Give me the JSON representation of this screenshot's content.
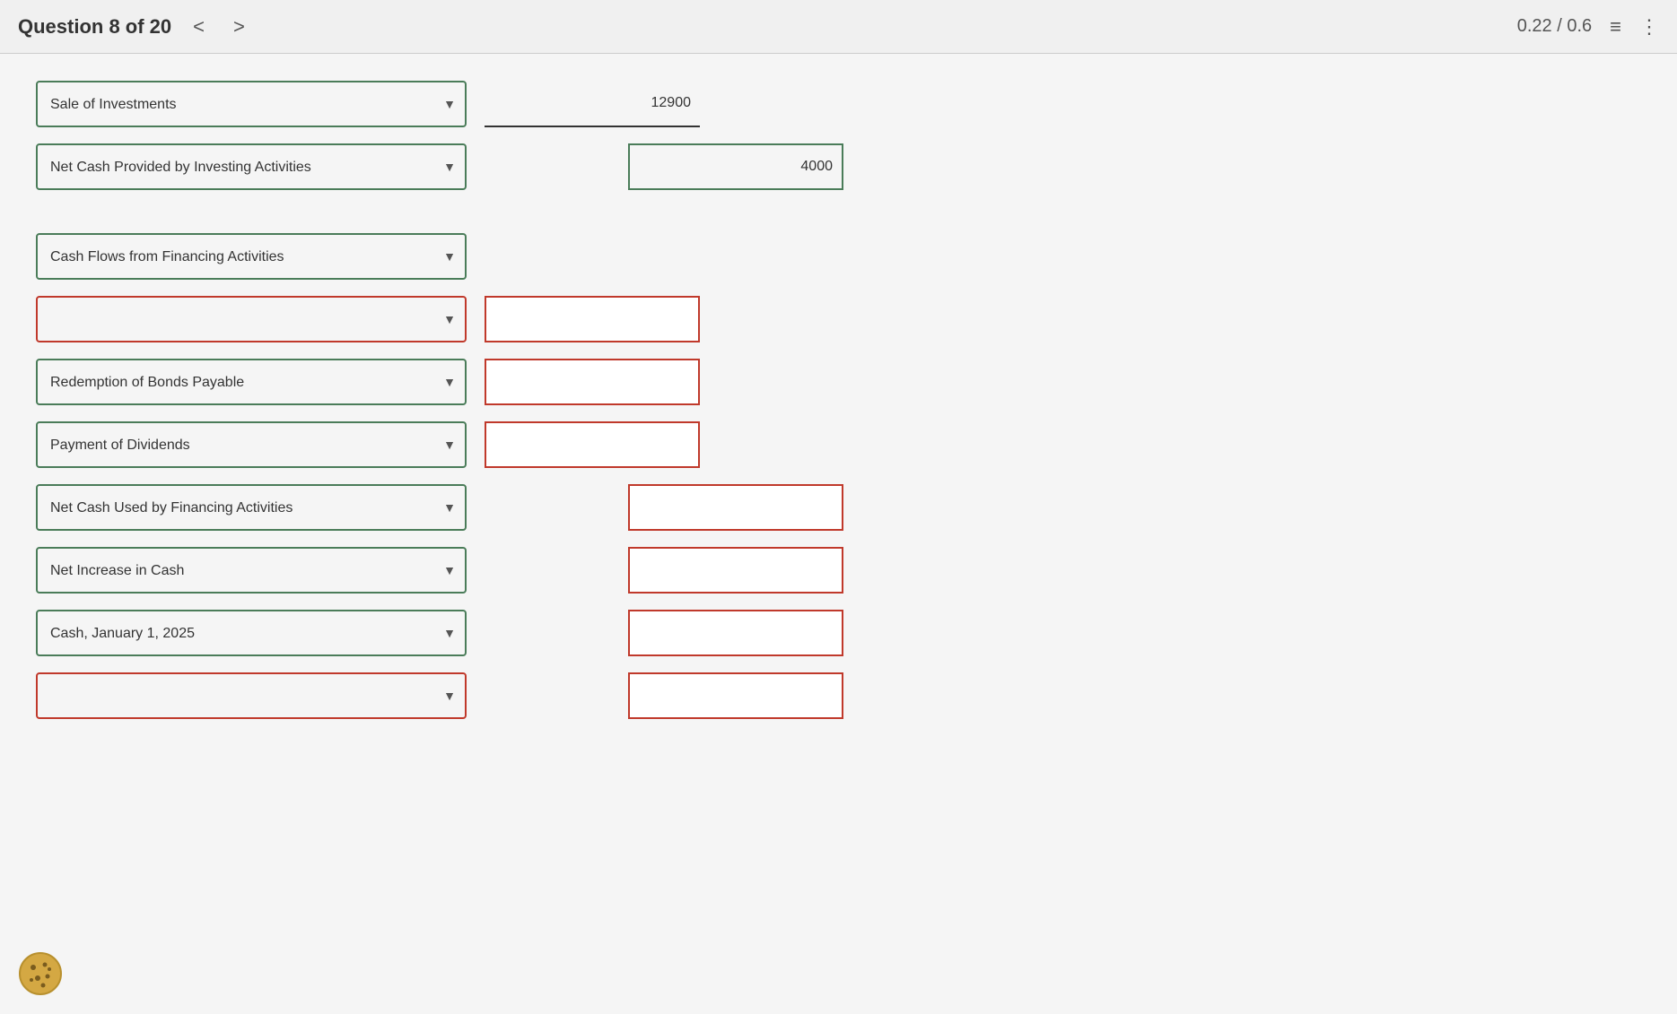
{
  "header": {
    "question_label": "Question 8 of 20",
    "nav_prev": "<",
    "nav_next": ">",
    "score": "0.22 / 0.6",
    "list_icon": "≡",
    "menu_icon": "⋮"
  },
  "rows": [
    {
      "id": "sale-investments",
      "dropdown_label": "Sale of Investments",
      "dropdown_border": "green",
      "col1_value": "12900",
      "col1_border": "underline",
      "col2_value": "",
      "col2_border": "none"
    },
    {
      "id": "net-cash-investing",
      "dropdown_label": "Net Cash Provided by Investing Activities",
      "dropdown_border": "green",
      "col1_value": "",
      "col1_border": "none",
      "col2_value": "4000",
      "col2_border": "green"
    },
    {
      "id": "gap1",
      "type": "gap"
    },
    {
      "id": "cash-flows-financing",
      "dropdown_label": "Cash Flows from Financing Activities",
      "dropdown_border": "green",
      "col1_value": "",
      "col1_border": "none",
      "col2_value": "",
      "col2_border": "none",
      "show_inputs": false
    },
    {
      "id": "blank-row",
      "dropdown_label": "",
      "dropdown_border": "red",
      "col1_value": "",
      "col1_border": "red",
      "col2_value": "",
      "col2_border": "none"
    },
    {
      "id": "redemption-bonds",
      "dropdown_label": "Redemption of Bonds Payable",
      "dropdown_border": "green",
      "col1_value": "",
      "col1_border": "red",
      "col2_value": "",
      "col2_border": "none"
    },
    {
      "id": "payment-dividends",
      "dropdown_label": "Payment of Dividends",
      "dropdown_border": "green",
      "col1_value": "",
      "col1_border": "red",
      "col2_value": "",
      "col2_border": "none",
      "underline_col1": true
    },
    {
      "id": "net-cash-financing",
      "dropdown_label": "Net Cash Used by Financing Activities",
      "dropdown_border": "green",
      "col1_value": "",
      "col1_border": "none",
      "col2_value": "",
      "col2_border": "red"
    },
    {
      "id": "net-increase-cash",
      "dropdown_label": "Net Increase in Cash",
      "dropdown_border": "green",
      "col1_value": "",
      "col1_border": "none",
      "col2_value": "",
      "col2_border": "red"
    },
    {
      "id": "cash-jan",
      "dropdown_label": "Cash, January 1, 2025",
      "dropdown_border": "green",
      "col1_value": "",
      "col1_border": "none",
      "col2_value": "",
      "col2_border": "red",
      "underline_col2": true
    },
    {
      "id": "last-row",
      "dropdown_label": "",
      "dropdown_border": "red",
      "col1_value": "",
      "col1_border": "none",
      "col2_value": "",
      "col2_border": "red"
    }
  ],
  "dropdown_options": [
    "Sale of Investments",
    "Net Cash Provided by Investing Activities",
    "Cash Flows from Financing Activities",
    "Redemption of Bonds Payable",
    "Payment of Dividends",
    "Net Cash Used by Financing Activities",
    "Net Increase in Cash",
    "Cash, January 1, 2025"
  ]
}
